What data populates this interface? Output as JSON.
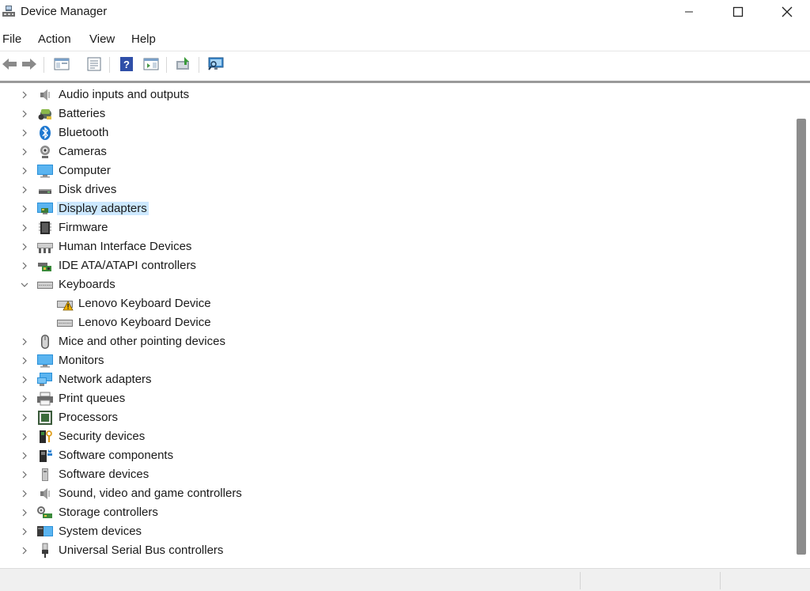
{
  "window": {
    "title": "Device Manager",
    "controls": [
      "minimize",
      "maximize",
      "close"
    ]
  },
  "menu": {
    "items": [
      "File",
      "Action",
      "View",
      "Help"
    ]
  },
  "toolbar": {
    "buttons": [
      {
        "icon": "back-arrow-icon"
      },
      {
        "icon": "forward-arrow-icon"
      },
      {
        "icon": "show-hide-console-tree-icon"
      },
      {
        "icon": "properties-icon"
      },
      {
        "icon": "help-icon"
      },
      {
        "icon": "action-pane-icon"
      },
      {
        "icon": "update-driver-icon"
      },
      {
        "icon": "scan-hardware-changes-icon"
      }
    ]
  },
  "tree": {
    "selected": "Display adapters",
    "selection_color": "#cce8ff",
    "items": [
      {
        "label": "Audio inputs and outputs",
        "icon": "speaker-icon",
        "expanded": false,
        "level": 0
      },
      {
        "label": "Batteries",
        "icon": "battery-icon",
        "expanded": false,
        "level": 0
      },
      {
        "label": "Bluetooth",
        "icon": "bluetooth-icon",
        "expanded": false,
        "level": 0
      },
      {
        "label": "Cameras",
        "icon": "camera-icon",
        "expanded": false,
        "level": 0
      },
      {
        "label": "Computer",
        "icon": "computer-icon",
        "expanded": false,
        "level": 0
      },
      {
        "label": "Disk drives",
        "icon": "disk-drive-icon",
        "expanded": false,
        "level": 0
      },
      {
        "label": "Display adapters",
        "icon": "display-adapter-icon",
        "expanded": false,
        "level": 0
      },
      {
        "label": "Firmware",
        "icon": "firmware-icon",
        "expanded": false,
        "level": 0
      },
      {
        "label": "Human Interface Devices",
        "icon": "hid-icon",
        "expanded": false,
        "level": 0
      },
      {
        "label": "IDE ATA/ATAPI controllers",
        "icon": "ide-controller-icon",
        "expanded": false,
        "level": 0
      },
      {
        "label": "Keyboards",
        "icon": "keyboard-icon",
        "expanded": true,
        "level": 0
      },
      {
        "label": "Lenovo Keyboard Device",
        "icon": "keyboard-warning-icon",
        "level": 1,
        "warning": true
      },
      {
        "label": "Lenovo Keyboard Device",
        "icon": "keyboard-icon",
        "level": 1
      },
      {
        "label": "Mice and other pointing devices",
        "icon": "mouse-icon",
        "expanded": false,
        "level": 0
      },
      {
        "label": "Monitors",
        "icon": "monitor-icon",
        "expanded": false,
        "level": 0
      },
      {
        "label": "Network adapters",
        "icon": "network-adapter-icon",
        "expanded": false,
        "level": 0
      },
      {
        "label": "Print queues",
        "icon": "printer-icon",
        "expanded": false,
        "level": 0
      },
      {
        "label": "Processors",
        "icon": "processor-icon",
        "expanded": false,
        "level": 0
      },
      {
        "label": "Security devices",
        "icon": "security-key-icon",
        "expanded": false,
        "level": 0
      },
      {
        "label": "Software components",
        "icon": "software-component-icon",
        "expanded": false,
        "level": 0
      },
      {
        "label": "Software devices",
        "icon": "software-device-icon",
        "expanded": false,
        "level": 0
      },
      {
        "label": "Sound, video and game controllers",
        "icon": "sound-controller-icon",
        "expanded": false,
        "level": 0
      },
      {
        "label": "Storage controllers",
        "icon": "storage-controller-icon",
        "expanded": false,
        "level": 0
      },
      {
        "label": "System devices",
        "icon": "system-device-icon",
        "expanded": false,
        "level": 0
      },
      {
        "label": "Universal Serial Bus controllers",
        "icon": "usb-icon",
        "expanded": false,
        "level": 0
      }
    ]
  }
}
